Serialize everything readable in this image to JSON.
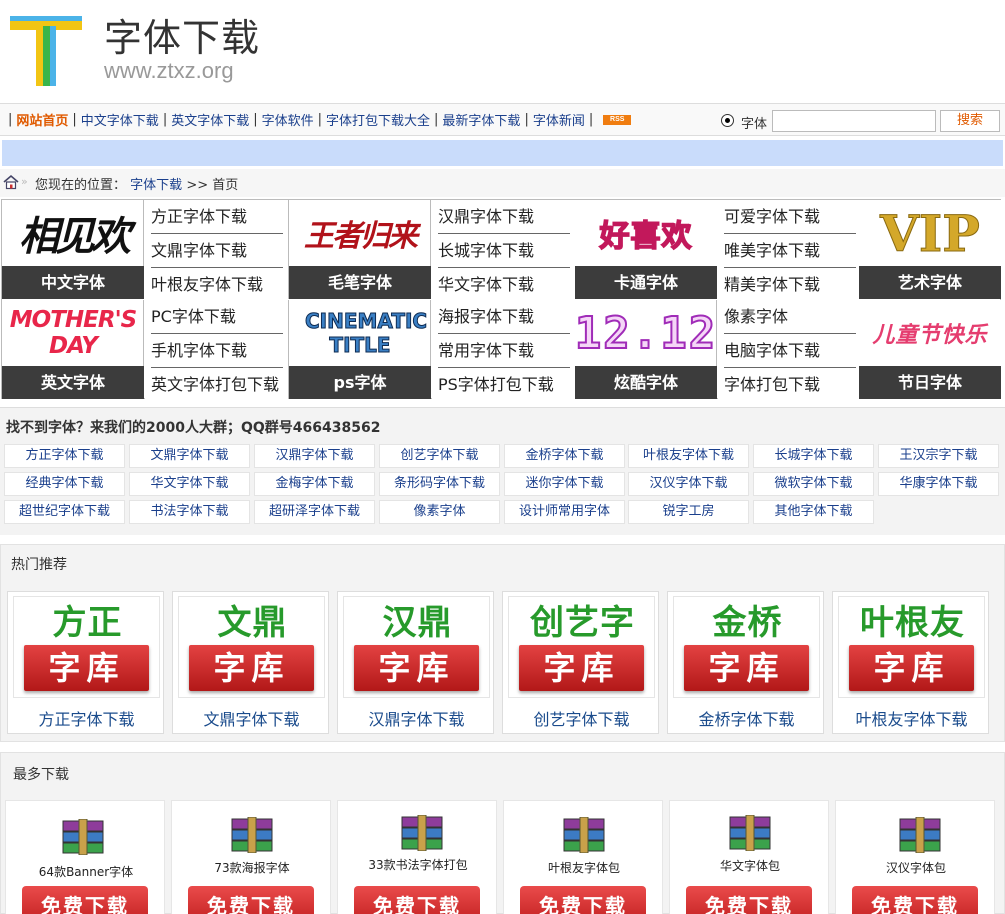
{
  "header": {
    "title": "字体下载",
    "url": "www.ztxz.org"
  },
  "nav": {
    "items": [
      "网站首页",
      "中文字体下载",
      "英文字体下载",
      "字体软件",
      "字体打包下载大全",
      "最新字体下载",
      "字体新闻"
    ],
    "rss_label": "RSS",
    "search_option": "字体",
    "search_value": "",
    "search_button": "搜索"
  },
  "breadcrumb": {
    "prefix": "您现在的位置：",
    "link": "字体下载",
    "separator": ">>",
    "current": "首页"
  },
  "categories": {
    "blocks": [
      {
        "label": "中文字体",
        "image_text": "相见欢"
      },
      {
        "label": "毛笔字体",
        "image_text": "王者归来"
      },
      {
        "label": "卡通字体",
        "image_text": "好喜欢"
      },
      {
        "label": "艺术字体",
        "image_text": "VIP"
      },
      {
        "label": "英文字体",
        "image_text": "MOTHER'S DAY"
      },
      {
        "label": "ps字体",
        "image_text": "CINEMATIC TITLE"
      },
      {
        "label": "炫酷字体",
        "image_text": "12.12"
      },
      {
        "label": "节日字体",
        "image_text": "儿童节快乐"
      }
    ],
    "link_columns": [
      [
        "方正字体下载",
        "文鼎字体下载",
        "叶根友字体下载",
        "PC字体下载",
        "手机字体下载",
        "英文字体打包下载"
      ],
      [
        "汉鼎字体下载",
        "长城字体下载",
        "华文字体下载",
        "海报字体下载",
        "常用字体下载",
        "PS字体打包下载"
      ],
      [
        "可爱字体下载",
        "唯美字体下载",
        "精美字体下载",
        "像素字体",
        "电脑字体下载",
        "字体打包下载"
      ]
    ]
  },
  "qq": {
    "title": "找不到字体？来我们的2000人大群；QQ群号466438562",
    "tags": [
      "方正字体下载",
      "文鼎字体下载",
      "汉鼎字体下载",
      "创艺字体下载",
      "金桥字体下载",
      "叶根友字体下载",
      "长城字体下载",
      "王汉宗字下载",
      "经典字体下载",
      "华文字体下载",
      "金梅字体下载",
      "条形码字体下载",
      "迷你字体下载",
      "汉仪字体下载",
      "微软字体下载",
      "华康字体下载",
      "超世纪字体下载",
      "书法字体下载",
      "超研泽字体下载",
      "像素字体",
      "设计师常用字体",
      "锐字工房",
      "其他字体下载"
    ]
  },
  "hot": {
    "title": "热门推荐",
    "items": [
      {
        "name": "方正",
        "ku": "字库",
        "caption": "方正字体下载"
      },
      {
        "name": "文鼎",
        "ku": "字库",
        "caption": "文鼎字体下载"
      },
      {
        "name": "汉鼎",
        "ku": "字库",
        "caption": "汉鼎字体下载"
      },
      {
        "name": "创艺字",
        "ku": "字库",
        "caption": "创艺字体下载"
      },
      {
        "name": "金桥",
        "ku": "字库",
        "caption": "金桥字体下载"
      },
      {
        "name": "叶根友",
        "ku": "字库",
        "caption": "叶根友字体下载"
      }
    ]
  },
  "most": {
    "title": "最多下载",
    "items": [
      {
        "name": "64款Banner字体",
        "button": "免费下载"
      },
      {
        "name": "73款海报字体",
        "button": "免费下载"
      },
      {
        "name": "33款书法字体打包",
        "button": "免费下载"
      },
      {
        "name": "叶根友字体包",
        "button": "免费下载"
      },
      {
        "name": "华文字体包",
        "button": "免费下载"
      },
      {
        "name": "汉仪字体包",
        "button": "免费下载"
      }
    ]
  },
  "colors": {
    "nav_highlight": "#e05a00",
    "link": "#1a3f8c",
    "band": "#c9dcfb",
    "label_bg": "#3c3c3c",
    "green": "#279a2b",
    "red": "#c01e1e"
  }
}
